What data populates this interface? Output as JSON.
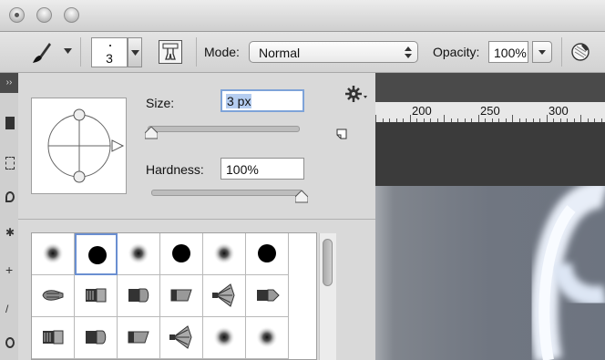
{
  "options_bar": {
    "brush_size_value": "3",
    "mode_label": "Mode:",
    "mode_value": "Normal",
    "opacity_label": "Opacity:",
    "opacity_value": "100%"
  },
  "brush_panel": {
    "size_label": "Size:",
    "size_value": "3 px",
    "size_level": 0.0,
    "hardness_label": "Hardness:",
    "hardness_value": "100%",
    "hardness_level": 1.0,
    "presets": [
      {
        "kind": "soft-round"
      },
      {
        "kind": "hard-round",
        "selected": true
      },
      {
        "kind": "soft-round"
      },
      {
        "kind": "hard-round"
      },
      {
        "kind": "soft-round"
      },
      {
        "kind": "hard-round"
      },
      {
        "kind": "bristle-round"
      },
      {
        "kind": "bristle-flat"
      },
      {
        "kind": "bristle-blunt"
      },
      {
        "kind": "bristle-angle"
      },
      {
        "kind": "bristle-fan"
      },
      {
        "kind": "bristle-point"
      },
      {
        "kind": "bristle-flat"
      },
      {
        "kind": "bristle-blunt"
      },
      {
        "kind": "bristle-angle"
      },
      {
        "kind": "bristle-fan"
      },
      {
        "kind": "soft-round"
      },
      {
        "kind": "soft-round"
      }
    ]
  },
  "ruler": {
    "labels": [
      "200",
      "250",
      "300"
    ]
  },
  "icons": [
    "brush-icon",
    "chevron-down-icon",
    "brush-panel-toggle-icon",
    "gear-icon",
    "new-preset-icon",
    "pressure-opacity-icon"
  ],
  "colors": {
    "selection_border": "#6a8fd1",
    "canvas_dark": "#3b3b3b"
  }
}
